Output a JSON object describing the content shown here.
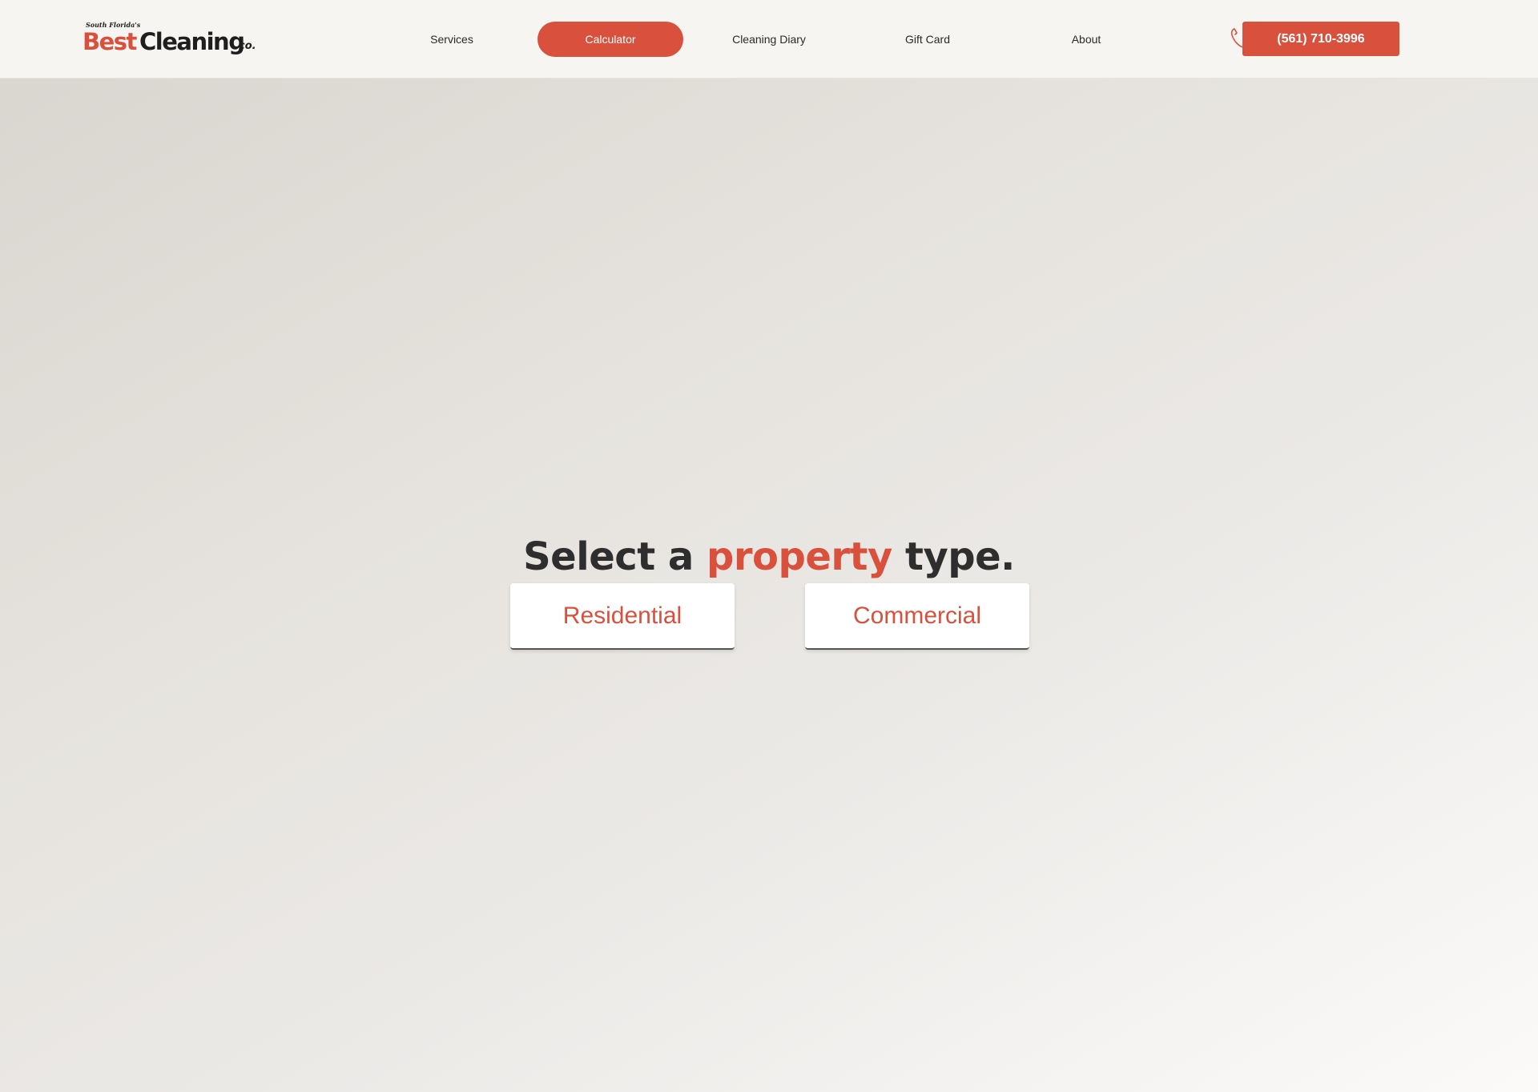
{
  "brand": {
    "tagline": "South Florida's",
    "name_part1": "Best",
    "name_part2": "Cleaning",
    "suffix": "co."
  },
  "nav": {
    "items": [
      {
        "label": "Services"
      },
      {
        "label": "Calculator",
        "active": true
      },
      {
        "label": "Cleaning Diary"
      },
      {
        "label": "Gift Card"
      },
      {
        "label": "About"
      }
    ],
    "phone_label": "(561) 710-3996"
  },
  "main": {
    "heading_before": "Select a ",
    "heading_accent": "property",
    "heading_after": " type.",
    "options": [
      {
        "label": "Residential"
      },
      {
        "label": "Commercial"
      }
    ]
  },
  "colors": {
    "accent": "#d9503d",
    "text_dark": "#2e2e2e",
    "header_bg": "#f6f5f2"
  },
  "icons": {
    "phone": "phone-icon"
  }
}
